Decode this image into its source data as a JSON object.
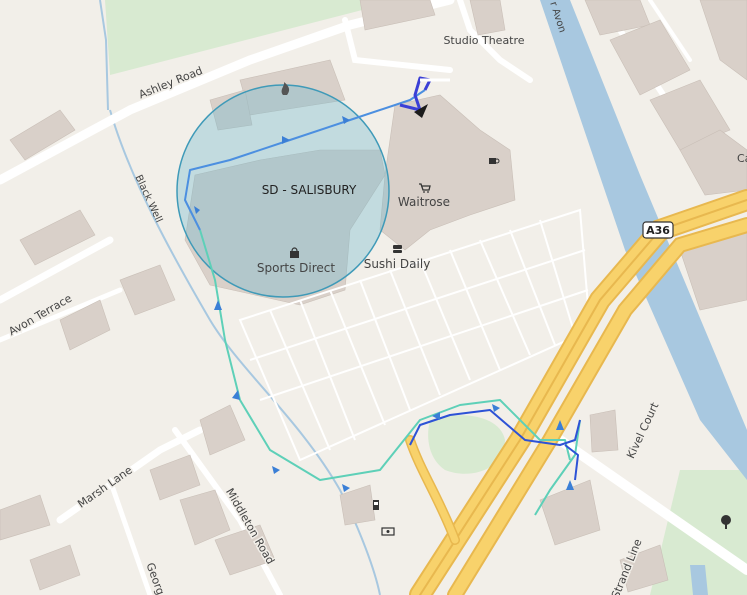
{
  "geofence": {
    "name": "SD - SALISBURY",
    "fill_color": "#6ab7cf",
    "stroke_color": "#3f9ab8"
  },
  "places": {
    "studio_theatre": "Studio Theatre",
    "waitrose": "Waitrose",
    "sports_direct": "Sports Direct",
    "sushi_daily": "Sushi Daily"
  },
  "streets": {
    "ashley_road": "Ashley Road",
    "avon_terrace": "Avon Terrace",
    "marsh_lane": "Marsh Lane",
    "middleton_road": "Middleton Road",
    "kivel_court": "Kivel Court",
    "george_partial": "Georg",
    "strand_lane_partial": "Strand Line",
    "river_partial": "r Avon",
    "stream": "Black Well",
    "edge_partial": "Ca"
  },
  "road_shield": "A36",
  "icons": {
    "fire": "fire-station-icon",
    "cafe": "cafe-icon",
    "supermarket": "shopping-cart-icon",
    "shop": "shopping-bag-icon",
    "sushi": "sushi-icon",
    "fuel": "fuel-pump-icon",
    "atm": "atm-icon",
    "tree": "tree-icon"
  },
  "colors": {
    "land": "#f2efe9",
    "building": "#d9d0c9",
    "park": "#d8ead1",
    "water": "#a8c8e0",
    "trunk_road": "#f8d26b",
    "track_start": "#5ed0b8",
    "track_end": "#3b3fd6"
  }
}
